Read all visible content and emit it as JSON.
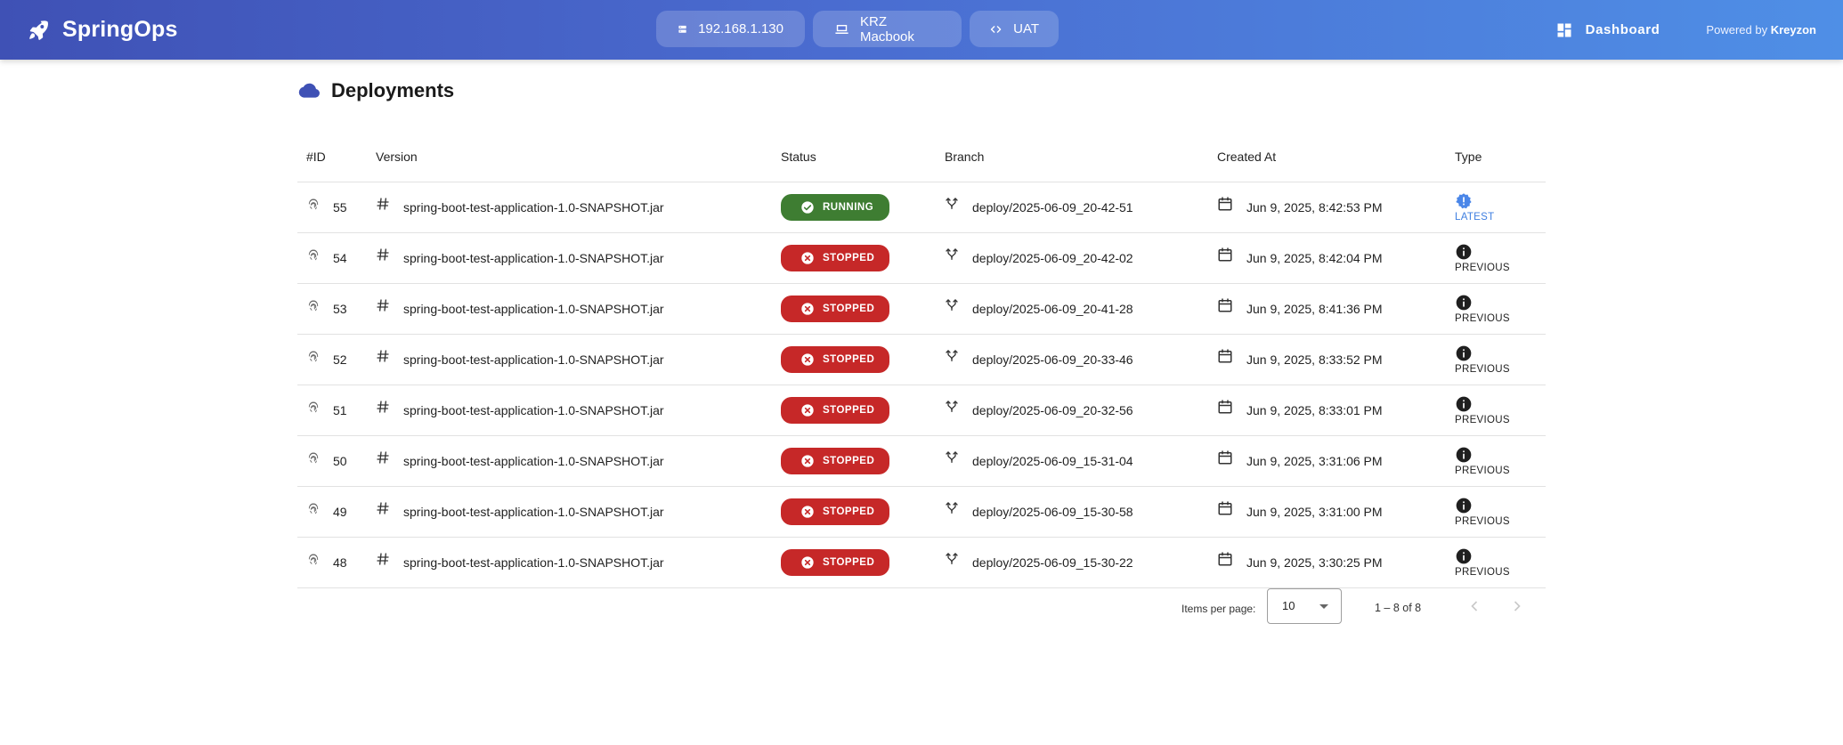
{
  "app": {
    "name": "SpringOps",
    "brand_icon": "rocket-icon",
    "header_bg": [
      "#3f51b5",
      "#4f8fe6"
    ]
  },
  "header": {
    "chips": [
      {
        "label": "192.168.1.130",
        "icon": "server-icon"
      },
      {
        "label": "KRZ Macbook",
        "icon": "laptop-icon"
      },
      {
        "label": "UAT",
        "icon": "code-icon"
      }
    ],
    "dashboard_label": "Dashboard",
    "powered_by_prefix": "Powered by",
    "powered_by_name": "Kreyzon"
  },
  "page": {
    "title": "Deployments",
    "title_icon": "cloud-icon",
    "accent": "#3f51b5"
  },
  "table": {
    "columns": [
      "#ID",
      "Version",
      "Status",
      "Branch",
      "Created At",
      "Type"
    ],
    "rows": [
      {
        "id": "55",
        "version": "spring-boot-test-application-1.0-SNAPSHOT.jar",
        "status": "RUNNING",
        "branch": "deploy/2025-06-09_20-42-51",
        "created_at": "Jun 9, 2025, 8:42:53 PM",
        "type": "LATEST"
      },
      {
        "id": "54",
        "version": "spring-boot-test-application-1.0-SNAPSHOT.jar",
        "status": "STOPPED",
        "branch": "deploy/2025-06-09_20-42-02",
        "created_at": "Jun 9, 2025, 8:42:04 PM",
        "type": "PREVIOUS"
      },
      {
        "id": "53",
        "version": "spring-boot-test-application-1.0-SNAPSHOT.jar",
        "status": "STOPPED",
        "branch": "deploy/2025-06-09_20-41-28",
        "created_at": "Jun 9, 2025, 8:41:36 PM",
        "type": "PREVIOUS"
      },
      {
        "id": "52",
        "version": "spring-boot-test-application-1.0-SNAPSHOT.jar",
        "status": "STOPPED",
        "branch": "deploy/2025-06-09_20-33-46",
        "created_at": "Jun 9, 2025, 8:33:52 PM",
        "type": "PREVIOUS"
      },
      {
        "id": "51",
        "version": "spring-boot-test-application-1.0-SNAPSHOT.jar",
        "status": "STOPPED",
        "branch": "deploy/2025-06-09_20-32-56",
        "created_at": "Jun 9, 2025, 8:33:01 PM",
        "type": "PREVIOUS"
      },
      {
        "id": "50",
        "version": "spring-boot-test-application-1.0-SNAPSHOT.jar",
        "status": "STOPPED",
        "branch": "deploy/2025-06-09_15-31-04",
        "created_at": "Jun 9, 2025, 3:31:06 PM",
        "type": "PREVIOUS"
      },
      {
        "id": "49",
        "version": "spring-boot-test-application-1.0-SNAPSHOT.jar",
        "status": "STOPPED",
        "branch": "deploy/2025-06-09_15-30-58",
        "created_at": "Jun 9, 2025, 3:31:00 PM",
        "type": "PREVIOUS"
      },
      {
        "id": "48",
        "version": "spring-boot-test-application-1.0-SNAPSHOT.jar",
        "status": "STOPPED",
        "branch": "deploy/2025-06-09_15-30-22",
        "created_at": "Jun 9, 2025, 3:30:25 PM",
        "type": "PREVIOUS"
      }
    ],
    "status_colors": {
      "RUNNING": "#3e7d32",
      "STOPPED": "#c62828"
    },
    "latest_color": "#3f7fe0"
  },
  "pagination": {
    "items_per_page_label": "Items per page:",
    "items_per_page_value": "10",
    "range_label": "1 – 8 of 8"
  }
}
